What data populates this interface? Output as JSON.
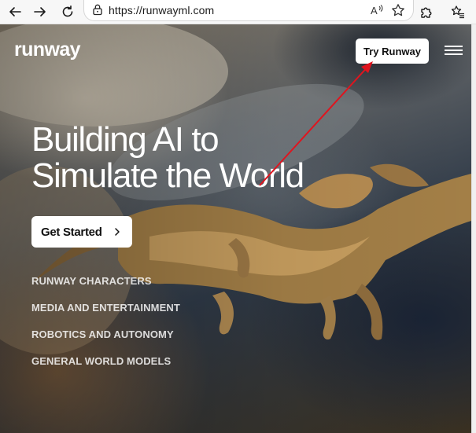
{
  "browser": {
    "url": "https://runwayml.com",
    "icons": {
      "back": "back-arrow-icon",
      "forward": "forward-arrow-icon",
      "refresh": "refresh-icon",
      "lock": "lock-icon",
      "read_aloud": "read-aloud-icon",
      "favorite": "star-icon",
      "extensions": "puzzle-icon",
      "favorites_bar": "favorites-icon"
    }
  },
  "site": {
    "logo": "runway",
    "try_button": "Try Runway",
    "menu_icon": "hamburger-menu-icon"
  },
  "hero": {
    "headline_line1": "Building AI to",
    "headline_line2": "Simulate the World",
    "cta_label": "Get Started",
    "links": [
      "RUNWAY CHARACTERS",
      "MEDIA AND ENTERTAINMENT",
      "ROBOTICS AND AUTONOMY",
      "GENERAL WORLD MODELS"
    ]
  },
  "colors": {
    "annotation_arrow": "#e0141e",
    "button_bg": "#ffffff",
    "text": "#ffffff"
  }
}
